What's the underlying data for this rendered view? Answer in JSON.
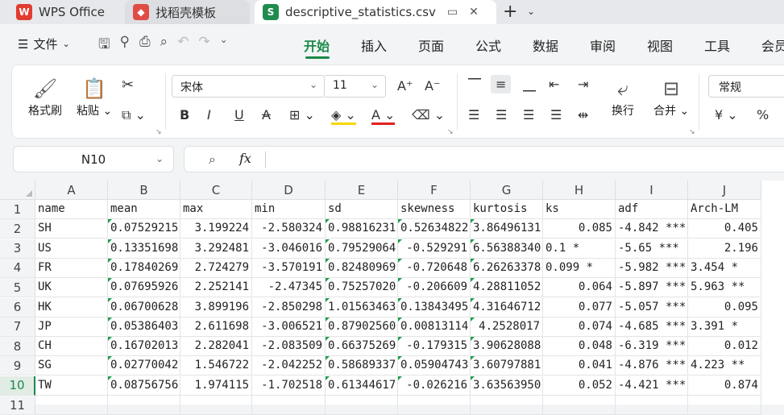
{
  "tabs": {
    "wps": "WPS Office",
    "template": "找稻壳模板",
    "document": "descriptive_statistics.csv"
  },
  "menu": {
    "file": "文件",
    "tabs": [
      "开始",
      "插入",
      "页面",
      "公式",
      "数据",
      "审阅",
      "视图",
      "工具",
      "会员"
    ]
  },
  "ribbon": {
    "format_painter": "格式刷",
    "paste": "粘贴",
    "font_name": "宋体",
    "font_size": "11",
    "wrap_text": "换行",
    "merge": "合并",
    "number_format": "常规",
    "currency": "¥",
    "percent": "%",
    "bold": "B",
    "italic": "I",
    "underline": "U",
    "strike": "A"
  },
  "formula": {
    "cell_ref": "N10",
    "fx": "fx",
    "content": ""
  },
  "grid": {
    "columns": [
      "A",
      "B",
      "C",
      "D",
      "E",
      "F",
      "G",
      "H",
      "I",
      "J"
    ],
    "rows": [
      [
        "name",
        "mean",
        "max",
        "min",
        "sd",
        "skewness",
        "kurtosis",
        "ks",
        "adf",
        "Arch-LM"
      ],
      [
        "SH",
        "0.07529215",
        "3.199224",
        "-2.580324",
        "0.98816231",
        "0.52634822",
        "3.86496131",
        "0.085",
        "-4.842 ***",
        "0.405"
      ],
      [
        "US",
        "0.13351698",
        "3.292481",
        "-3.046016",
        "0.79529064",
        "-0.529291",
        "6.56388340",
        "0.1 *",
        "-5.65 ***",
        "2.196"
      ],
      [
        "FR",
        "0.17840269",
        "2.724279",
        "-3.570191",
        "0.82480969",
        "-0.720648",
        "6.26263378",
        "0.099 *",
        "-5.982 ***",
        "3.454 *"
      ],
      [
        "UK",
        "0.07695926",
        "2.252141",
        "-2.47345",
        "0.75257020",
        "-0.206609",
        "4.28811052",
        "0.064",
        "-5.897 ***",
        "5.963 **"
      ],
      [
        "HK",
        "0.06700628",
        "3.899196",
        "-2.850298",
        "1.01563463",
        "0.13843495",
        "4.31646712",
        "0.077",
        "-5.057 ***",
        "0.095"
      ],
      [
        "JP",
        "0.05386403",
        "2.611698",
        "-3.006521",
        "0.87902560",
        "0.00813114",
        "4.2528017",
        "0.074",
        "-4.685 ***",
        "3.391 *"
      ],
      [
        "CH",
        "0.16702013",
        "2.282041",
        "-2.083509",
        "0.66375269",
        "-0.179315",
        "3.90628088",
        "0.048",
        "-6.319 ***",
        "0.012"
      ],
      [
        "SG",
        "0.02770042",
        "1.546722",
        "-2.042252",
        "0.58689337",
        "0.05904743",
        "3.60797881",
        "0.041",
        "-4.876 ***",
        "4.223 **"
      ],
      [
        "TW",
        "0.08756756",
        "1.974115",
        "-1.702518",
        "0.61344617",
        "-0.026216",
        "3.63563950",
        "0.052",
        "-4.421 ***",
        "0.874"
      ]
    ],
    "row_numbers": [
      "1",
      "2",
      "3",
      "4",
      "5",
      "6",
      "7",
      "8",
      "9",
      "10",
      "11"
    ]
  },
  "colors": {
    "accent": "#1a8a4a",
    "green_triangle": "#1e9c4e"
  }
}
